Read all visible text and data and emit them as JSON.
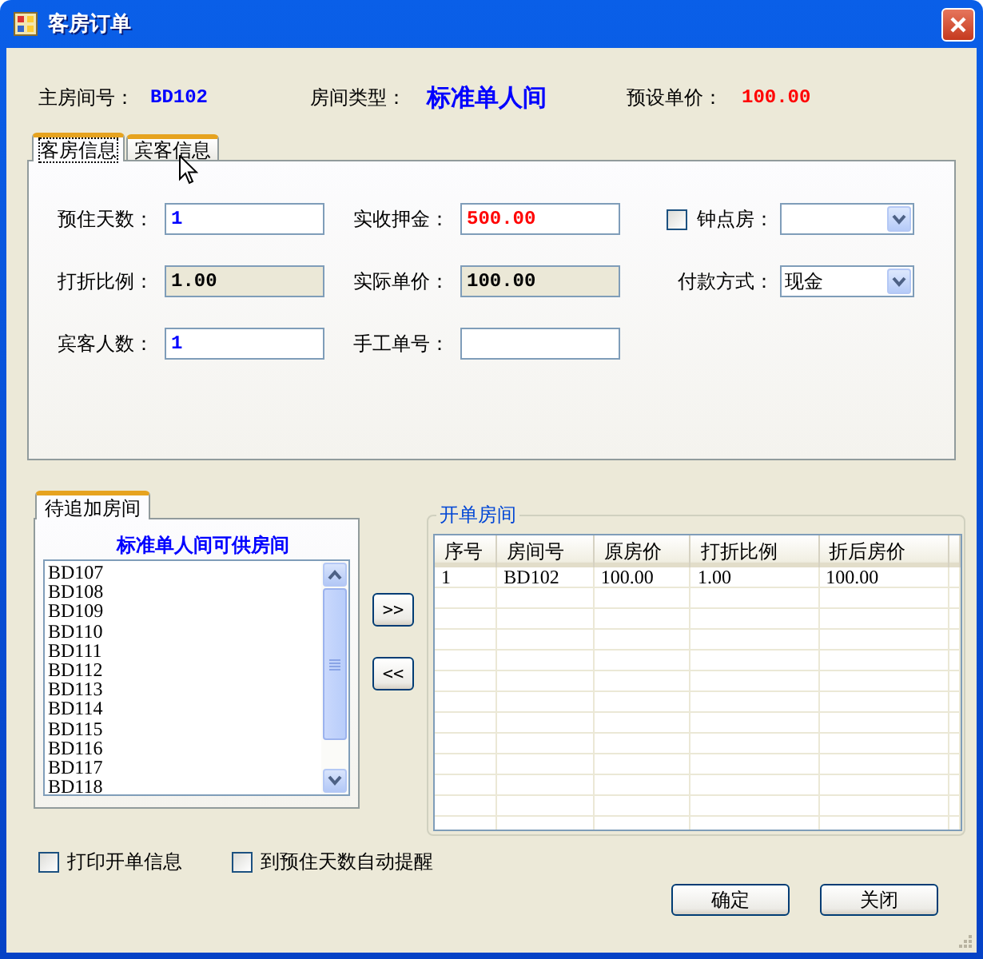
{
  "window": {
    "title": "客房订单"
  },
  "header": [
    {
      "label": "主房间号：",
      "value": "BD102",
      "kind": "code",
      "color": "#0000ff"
    },
    {
      "label": "房间类型：",
      "value": "标准单人间",
      "kind": "title",
      "color": "#0000ff"
    },
    {
      "label": "预设单价：",
      "value": "100.00",
      "kind": "code",
      "color": "#ff0000"
    }
  ],
  "tabs": [
    {
      "label": "客房信息",
      "selected": true
    },
    {
      "label": "宾客信息",
      "selected": false
    }
  ],
  "room_fields": [
    [
      {
        "kind": "input",
        "label": "预住天数：",
        "value": "1",
        "color": "#0000ff"
      },
      {
        "kind": "input",
        "label": "实收押金：",
        "value": "500.00",
        "color": "#ff0000"
      },
      {
        "kind": "check_combo",
        "label": "钟点房：",
        "checked": false
      }
    ],
    [
      {
        "kind": "readonly",
        "label": "打折比例：",
        "value": "1.00"
      },
      {
        "kind": "readonly",
        "label": "实际单价：",
        "value": "100.00"
      },
      {
        "kind": "combo",
        "label": "付款方式：",
        "value": "现金"
      }
    ],
    [
      {
        "kind": "input",
        "label": "宾客人数：",
        "value": "1",
        "color": "#0000ff"
      },
      {
        "kind": "input",
        "label": "手工单号："
      }
    ]
  ],
  "pending": {
    "tab": "待追加房间",
    "title": "标准单人间可供房间",
    "rooms": [
      "BD107",
      "BD108",
      "BD109",
      "BD110",
      "BD111",
      "BD112",
      "BD113",
      "BD114",
      "BD115",
      "BD116",
      "BD117",
      "BD118"
    ]
  },
  "move_buttons": [
    ">>",
    "<<"
  ],
  "order": {
    "title": "开单房间",
    "columns": [
      "序号",
      "房间号",
      "原房价",
      "打折比例",
      "折后房价"
    ],
    "rows": [
      [
        "1",
        "BD102",
        "100.00",
        "1.00",
        "100.00"
      ]
    ]
  },
  "options": [
    {
      "label": "打印开单信息",
      "checked": false
    },
    {
      "label": "到预住天数自动提醒",
      "checked": false
    }
  ],
  "buttons": [
    "确定",
    "关闭"
  ]
}
